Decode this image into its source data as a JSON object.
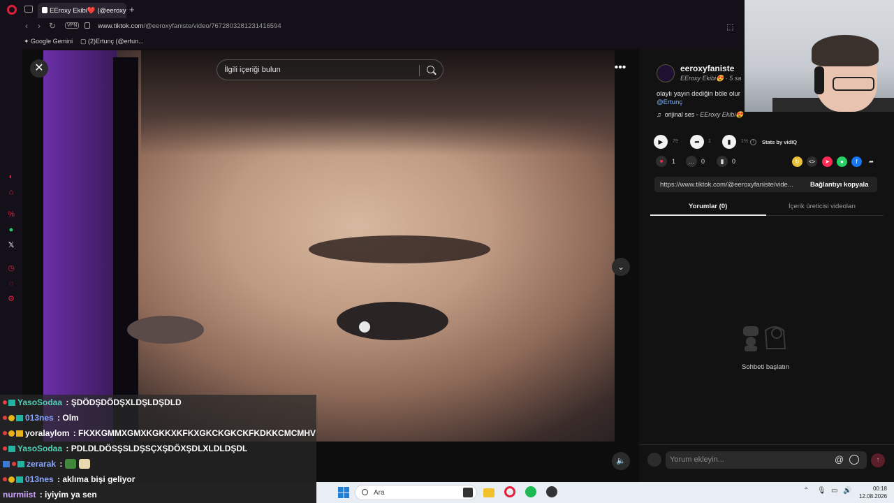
{
  "browser": {
    "tab_title": "EEroxy Ekibi❤️ (@eeroxy",
    "url_host": "www.tiktok.com",
    "url_path": "/@eeroxyfaniste/video/7672803281231416594",
    "vpn_label": "VPN",
    "bookmarks": [
      "Google Gemini",
      "(2)Ertunç (@ertun..."
    ]
  },
  "video": {
    "search_placeholder": "İlgili içeriği bulun"
  },
  "post": {
    "username": "eeroxyfaniste",
    "display_name": "EEroxy Ekibi😍",
    "time_ago": "· 5 sa",
    "description": "olaylı yayın dediğin böle olur",
    "mention": "@Ertunç",
    "sound": "orijinal ses",
    "sound_author": "EEroxy Ekibi😍",
    "stats": {
      "plays": "79",
      "shares": "1",
      "percent": "1%",
      "vidiq": "Stats by vidIQ"
    },
    "likes": "1",
    "comments": "0",
    "saves": "0",
    "link": "https://www.tiktok.com/@eeroxyfaniste/vide...",
    "copy_label": "Bağlantıyı kopyala",
    "tabs": [
      "Yorumlar (0)",
      "İçerik üreticisi videoları"
    ],
    "empty_comments": "Sohbeti başlatın",
    "comment_placeholder": "Yorum ekleyin..."
  },
  "chat": [
    {
      "name": "YasoSodaa",
      "color": "#4fd1b5",
      "message": ": ŞDÖDŞDÖDŞXLDŞLDŞDLD"
    },
    {
      "name": "013nes",
      "color": "#8aa8ff",
      "message": ": Olm"
    },
    {
      "name": "yoralaylom",
      "color": "#ffffff",
      "message": ": FKXKGMMXGMXKGKKXKFKXGKCKGKCKFKDKKCMCMHV"
    },
    {
      "name": "YasoSodaa",
      "color": "#4fd1b5",
      "message": ": PDLDLDÖSŞSLDŞSÇXŞDÖXŞDLXLDLDŞDL"
    },
    {
      "name": "zerarak",
      "color": "#8aa8ff",
      "message": ":"
    },
    {
      "name": "013nes",
      "color": "#8aa8ff",
      "message": ": aklıma bişi geliyor"
    },
    {
      "name": "nurmiist",
      "color": "#c9a0ff",
      "message": ": iyiyim ya sen"
    }
  ],
  "taskbar": {
    "search_placeholder": "Ara",
    "time": "00:18",
    "date": "12.08.2026"
  },
  "colors": {
    "accent": "#fe2c55",
    "link": "#7fb4ff",
    "tiktok_bg": "#121212"
  }
}
